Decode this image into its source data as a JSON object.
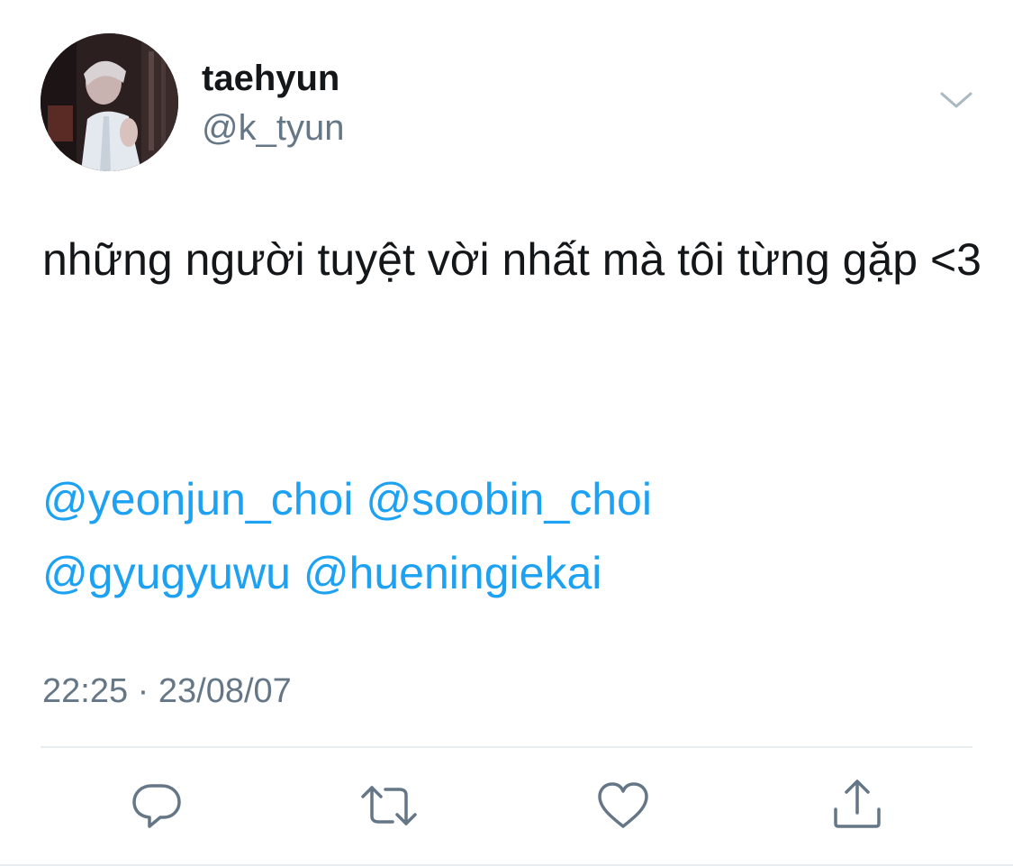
{
  "author": {
    "display_name": "taehyun",
    "handle": "@k_tyun"
  },
  "tweet": {
    "text": "những người tuyệt vời nhất mà tôi từng gặp <3",
    "mentions": [
      "@yeonjun_choi",
      "@soobin_choi",
      "@gyugyuwu",
      "@hueningiekai"
    ],
    "timestamp": "22:25 · 23/08/07"
  },
  "actions": {
    "reply": "reply-icon",
    "retweet": "retweet-icon",
    "like": "heart-icon",
    "share": "share-icon"
  },
  "colors": {
    "text": "#14171a",
    "secondary": "#657786",
    "link": "#1da1f2",
    "divider": "#e6ecf0",
    "icon": "#657786"
  }
}
